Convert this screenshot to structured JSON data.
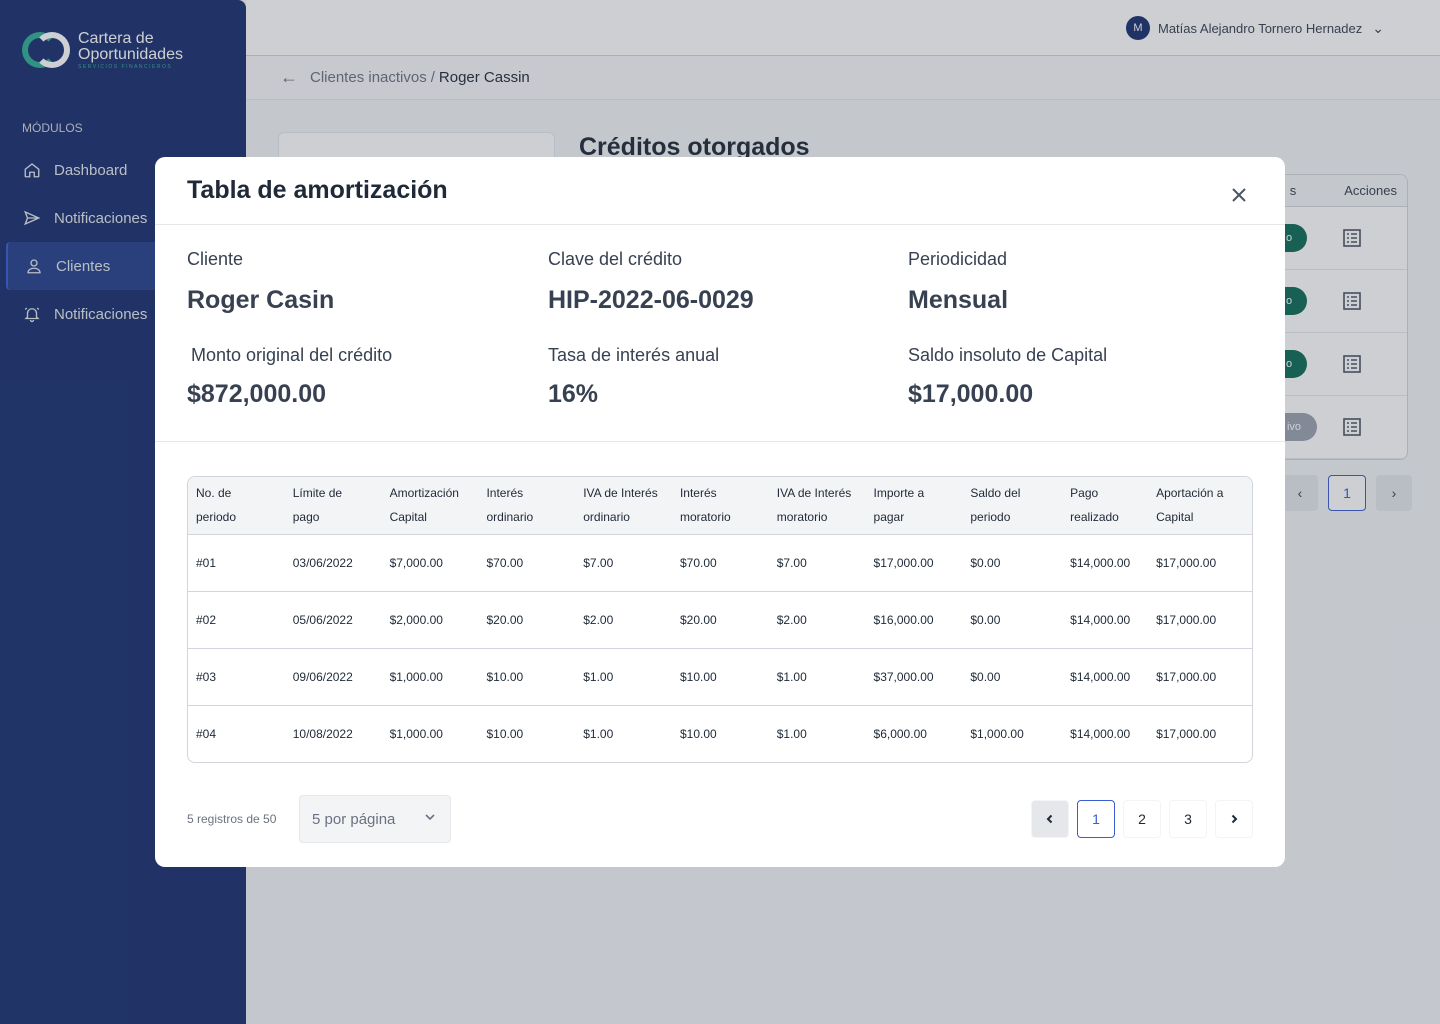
{
  "brand": {
    "line1": "Cartera de",
    "line2": "Oportunidades",
    "tagline": "SERVICIOS FINANCIEROS"
  },
  "sidebar": {
    "section_label": "MÓDULOS",
    "items": [
      {
        "label": "Dashboard",
        "icon": "home-icon"
      },
      {
        "label": "Notificaciones",
        "icon": "send-icon"
      },
      {
        "label": "Clientes",
        "icon": "user-icon",
        "active": true
      },
      {
        "label": "Notificaciones",
        "icon": "bell-icon"
      }
    ]
  },
  "header": {
    "user_initial": "M",
    "user_name": "Matías Alejandro Tornero Hernadez"
  },
  "breadcrumb": {
    "prev": "Clientes inactivos",
    "separator": "/",
    "current": "Roger Cassin"
  },
  "background": {
    "title": "Créditos otorgados",
    "table_header_partial": "s",
    "actions_header": "Acciones",
    "status_pills": [
      "o",
      "o",
      "o",
      "ivo"
    ],
    "pager_current": "1"
  },
  "modal": {
    "title": "Tabla de amortización",
    "info": {
      "client_label": "Cliente",
      "client_value": "Roger Casin",
      "key_label": "Clave del crédito",
      "key_value": "HIP-2022-06-0029",
      "period_label": "Periodicidad",
      "period_value": "Mensual",
      "amount_label": "Monto original del crédito",
      "amount_value": "$872,000.00",
      "rate_label": "Tasa de interés anual",
      "rate_value": "16%",
      "balance_label": "Saldo insoluto de Capital",
      "balance_value": "$17,000.00"
    },
    "table": {
      "headers": [
        [
          "No. de",
          "periodo"
        ],
        [
          "Límite de",
          "pago"
        ],
        [
          "Amortización",
          "Capital"
        ],
        [
          "Interés",
          "ordinario"
        ],
        [
          "IVA de Interés",
          "ordinario"
        ],
        [
          "Interés",
          "moratorio"
        ],
        [
          "IVA de Interés",
          "moratorio"
        ],
        [
          "Importe a",
          "pagar"
        ],
        [
          "Saldo del",
          "periodo"
        ],
        [
          "Pago",
          "realizado"
        ],
        [
          "Aportación a",
          "Capital"
        ]
      ],
      "rows": [
        [
          "#01",
          "03/06/2022",
          "$7,000.00",
          "$70.00",
          "$7.00",
          "$70.00",
          "$7.00",
          "$17,000.00",
          "$0.00",
          "$14,000.00",
          "$17,000.00"
        ],
        [
          "#02",
          "05/06/2022",
          "$2,000.00",
          "$20.00",
          "$2.00",
          "$20.00",
          "$2.00",
          "$16,000.00",
          "$0.00",
          "$14,000.00",
          "$17,000.00"
        ],
        [
          "#03",
          "09/06/2022",
          "$1,000.00",
          "$10.00",
          "$1.00",
          "$10.00",
          "$1.00",
          "$37,000.00",
          "$0.00",
          "$14,000.00",
          "$17,000.00"
        ],
        [
          "#04",
          "10/08/2022",
          "$1,000.00",
          "$10.00",
          "$1.00",
          "$10.00",
          "$1.00",
          "$6,000.00",
          "$1,000.00",
          "$14,000.00",
          "$17,000.00"
        ]
      ]
    },
    "footer": {
      "records": "5 registros de 50",
      "per_page": "5 por página",
      "pages": [
        "1",
        "2",
        "3"
      ],
      "current_page": "1"
    }
  }
}
